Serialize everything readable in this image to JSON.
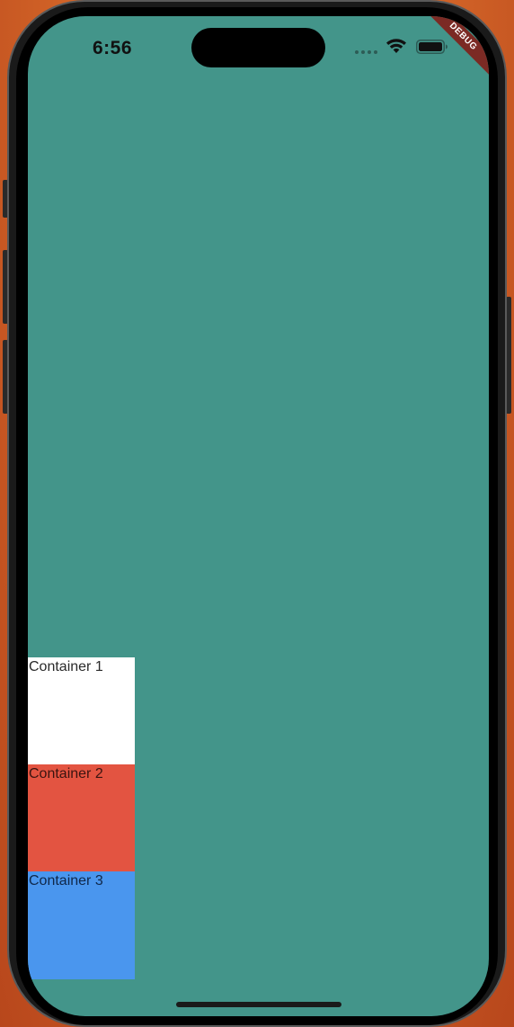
{
  "status_bar": {
    "time": "6:56",
    "wifi_icon": "wifi-icon",
    "battery_icon": "battery-icon"
  },
  "debug_banner": {
    "label": "DEBUG",
    "color": "#7b2a24"
  },
  "screen": {
    "background": "#43958a"
  },
  "containers": [
    {
      "label": "Container 1",
      "color": "#ffffff"
    },
    {
      "label": "Container 2",
      "color": "#e35441"
    },
    {
      "label": "Container 3",
      "color": "#4a96ee"
    }
  ]
}
